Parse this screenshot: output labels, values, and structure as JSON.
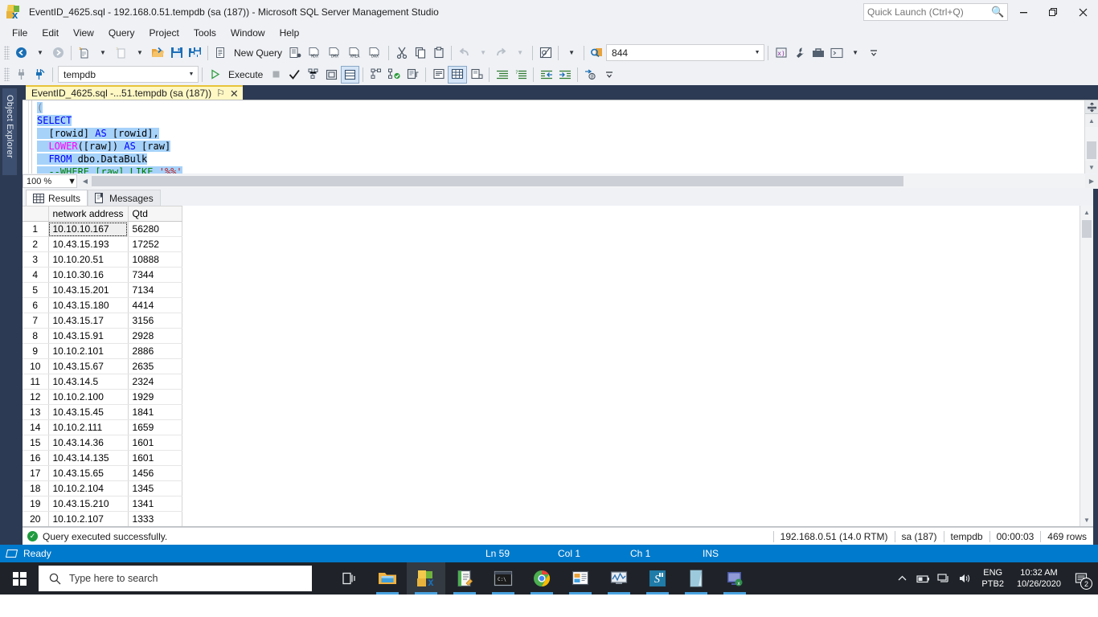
{
  "titlebar": {
    "title": "EventID_4625.sql - 192.168.0.51.tempdb (sa (187)) - Microsoft SQL Server Management Studio",
    "quick_launch_placeholder": "Quick Launch (Ctrl+Q)",
    "minimize_label": "—",
    "restore_label": "❐",
    "close_label": "✕"
  },
  "menubar": {
    "items": [
      "File",
      "Edit",
      "View",
      "Query",
      "Project",
      "Tools",
      "Window",
      "Help"
    ]
  },
  "toolbar": {
    "new_query_label": "New Query",
    "execute_label": "Execute",
    "database_value": "tempdb",
    "rows_value": "844"
  },
  "object_explorer": {
    "tab_label": "Object Explorer"
  },
  "document_tab": {
    "label": "EventID_4625.sql -...51.tempdb (sa (187))",
    "pin_glyph": "⚐",
    "close_glyph": "✕"
  },
  "editor": {
    "zoom_value": "100 %",
    "lines": [
      {
        "parts": [
          {
            "t": "(",
            "c": "pl",
            "s": true
          }
        ]
      },
      {
        "parts": [
          {
            "t": "SELECT",
            "c": "kw",
            "s": true
          }
        ]
      },
      {
        "parts": [
          {
            "t": "  [rowid] ",
            "c": "tx",
            "s": true
          },
          {
            "t": "AS",
            "c": "kw",
            "s": true
          },
          {
            "t": " [rowid],",
            "c": "tx",
            "s": true
          }
        ]
      },
      {
        "parts": [
          {
            "t": "  ",
            "c": "tx",
            "s": true
          },
          {
            "t": "LOWER",
            "c": "fn",
            "s": true
          },
          {
            "t": "([raw]) ",
            "c": "tx",
            "s": true
          },
          {
            "t": "AS",
            "c": "kw",
            "s": true
          },
          {
            "t": " [raw]",
            "c": "tx",
            "s": true
          }
        ]
      },
      {
        "parts": [
          {
            "t": "  ",
            "c": "tx",
            "s": true
          },
          {
            "t": "FROM",
            "c": "kw",
            "s": true
          },
          {
            "t": " dbo.DataBulk",
            "c": "tx",
            "s": true
          }
        ]
      },
      {
        "parts": [
          {
            "t": "  --WHERE [raw] LIKE ",
            "c": "cm",
            "s": true
          },
          {
            "t": "'%%'",
            "c": "str",
            "s": true
          }
        ]
      }
    ]
  },
  "results": {
    "tabs": [
      {
        "label": "Results",
        "active": true,
        "icon": "grid-icon"
      },
      {
        "label": "Messages",
        "active": false,
        "icon": "message-icon"
      }
    ],
    "columns": [
      "",
      "network address",
      "Qtd"
    ],
    "rows": [
      {
        "n": "1",
        "addr": "10.10.10.167",
        "qtd": "56280"
      },
      {
        "n": "2",
        "addr": "10.43.15.193",
        "qtd": "17252"
      },
      {
        "n": "3",
        "addr": "10.10.20.51",
        "qtd": "10888"
      },
      {
        "n": "4",
        "addr": "10.10.30.16",
        "qtd": "7344"
      },
      {
        "n": "5",
        "addr": "10.43.15.201",
        "qtd": "7134"
      },
      {
        "n": "6",
        "addr": "10.43.15.180",
        "qtd": "4414"
      },
      {
        "n": "7",
        "addr": "10.43.15.17",
        "qtd": "3156"
      },
      {
        "n": "8",
        "addr": "10.43.15.91",
        "qtd": "2928"
      },
      {
        "n": "9",
        "addr": "10.10.2.101",
        "qtd": "2886"
      },
      {
        "n": "10",
        "addr": "10.43.15.67",
        "qtd": "2635"
      },
      {
        "n": "11",
        "addr": "10.43.14.5",
        "qtd": "2324"
      },
      {
        "n": "12",
        "addr": "10.10.2.100",
        "qtd": "1929"
      },
      {
        "n": "13",
        "addr": "10.43.15.45",
        "qtd": "1841"
      },
      {
        "n": "14",
        "addr": "10.10.2.111",
        "qtd": "1659"
      },
      {
        "n": "15",
        "addr": "10.43.14.36",
        "qtd": "1601"
      },
      {
        "n": "16",
        "addr": "10.43.14.135",
        "qtd": "1601"
      },
      {
        "n": "17",
        "addr": "10.43.15.65",
        "qtd": "1456"
      },
      {
        "n": "18",
        "addr": "10.10.2.104",
        "qtd": "1345"
      },
      {
        "n": "19",
        "addr": "10.43.15.210",
        "qtd": "1341"
      },
      {
        "n": "20",
        "addr": "10.10.2.107",
        "qtd": "1333"
      }
    ],
    "selected_cell": "10.10.10.167"
  },
  "query_status": {
    "message": "Query executed successfully.",
    "server": "192.168.0.51 (14.0 RTM)",
    "login": "sa (187)",
    "database": "tempdb",
    "elapsed": "00:00:03",
    "row_count": "469 rows"
  },
  "statusbar": {
    "ready": "Ready",
    "line": "Ln 59",
    "col": "Col 1",
    "ch": "Ch 1",
    "ins": "INS"
  },
  "taskbar": {
    "search_placeholder": "Type here to search",
    "language_line1": "ENG",
    "language_line2": "PTB2",
    "time": "10:32 AM",
    "date": "10/26/2020",
    "notification_count": "2"
  },
  "colors": {
    "accent": "#007acc",
    "tab_yellow": "#fff8c4",
    "chrome": "#eff1f5",
    "workspace": "#2d3a53",
    "keyword": "#0000ff",
    "function": "#ff00ff",
    "comment": "#008000",
    "string": "#c41a16",
    "selection": "#a6d2fa"
  }
}
